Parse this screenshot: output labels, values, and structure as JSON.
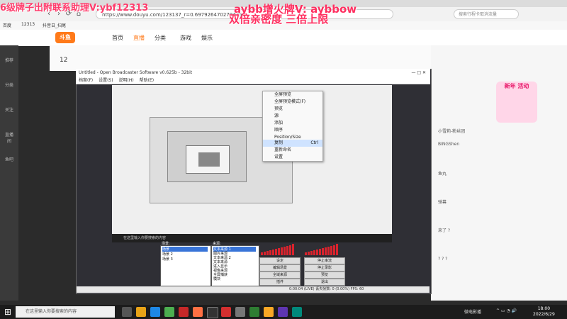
{
  "overlays": {
    "top_left": "6级牌子出附联系助理V:ybf12313",
    "top_center_1": "aybb增火牌V: aybbow",
    "top_center_2": "双倍亲密度 三倍上限"
  },
  "browser": {
    "url": "https://www.douyu.com/123137_r=0.6979264702794254",
    "search_placeholder": "搜索行程卡取消流量",
    "bookmarks": [
      "百度",
      "12313",
      "抖音日_扫尾"
    ]
  },
  "site": {
    "logo": "斗鱼",
    "nav": [
      "首页",
      "直播",
      "分类",
      "游戏",
      "娱乐"
    ],
    "sidebar": [
      "推荐",
      "分类",
      "关注",
      "直播间",
      "鱼吧"
    ],
    "room_number": "12",
    "promo_text": "新年 活动",
    "chat": [
      "小雪莉-粉丝团",
      "BINGShen",
      "鱼丸",
      "弹幕",
      "来了 ?",
      "? ? ?"
    ]
  },
  "obs": {
    "title": "Untitled - Open Broadcaster Software v0.625b - 32bit",
    "menu": [
      "档案(F)",
      "设置(S)",
      "说明(H)",
      "帮助(E)"
    ],
    "context_menu": [
      "全屏预览",
      "全屏预览模式(F)",
      "预览",
      "源",
      "添加",
      "顺序",
      "Position/Size",
      "复制",
      "重新命名",
      "设置"
    ],
    "context_shortcut": "Ctrl",
    "scenes_label": "场景:",
    "scenes": [
      "场景",
      "场景 2",
      "场景 3"
    ],
    "sources_label": "来源:",
    "sources": [
      "文本来源 1",
      "图片来源",
      "文本来源 2",
      "文本来源",
      "进入显示",
      "视像来源",
      "全屏捕获",
      "模块"
    ],
    "buttons": [
      "设定",
      "停止串流",
      "编辑场景",
      "停止录影",
      "全域来源",
      "预览",
      "插件",
      "退出"
    ],
    "status": "0:00:04 (LIVE)   丢失帧数:  0 (0.00%)      FPS: 60",
    "windows_mini_text": "在这里输入你要搜索的内容"
  },
  "taskbar": {
    "search_placeholder": "在这里输入你要搜索的内容",
    "weather": "微电影播",
    "time": "18:00",
    "date": "2022/6/29"
  },
  "colors": {
    "overlay_red": "#ff2f60",
    "douyu_orange": "#ff7a1a",
    "meter_red": "#d9232d",
    "taskbar": "#1c1c1c"
  }
}
